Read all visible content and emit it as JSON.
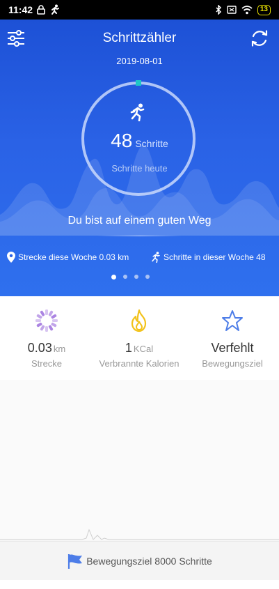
{
  "status_bar": {
    "time": "11:42",
    "battery": "13"
  },
  "header": {
    "title": "Schrittzähler",
    "date": "2019-08-01"
  },
  "summary": {
    "steps_value": "48",
    "steps_unit": "Schritte",
    "steps_caption": "Schritte heute",
    "motivation": "Du bist auf einem guten Weg"
  },
  "week": {
    "distance_text": "Strecke diese Woche 0.03 km",
    "steps_text": "Schritte in dieser Woche 48"
  },
  "pager": {
    "count": 4,
    "active_index": 0
  },
  "stats": [
    {
      "value": "0.03",
      "unit": "km",
      "label": "Strecke",
      "icon": "ring-icon",
      "color": "#a77de0"
    },
    {
      "value": "1",
      "unit": "KCal",
      "label": "Verbrannte Kalorien",
      "icon": "flame-icon",
      "color": "#f2c21a"
    },
    {
      "value": "Verfehlt",
      "unit": "",
      "label": "Bewegungsziel",
      "icon": "star-icon",
      "color": "#4d7de8"
    }
  ],
  "goal": {
    "text": "Bewegungsziel 8000 Schritte"
  },
  "colors": {
    "hero": "#2a62e6",
    "accent": "#1ec7c7",
    "goal_flag": "#4d7de8"
  }
}
